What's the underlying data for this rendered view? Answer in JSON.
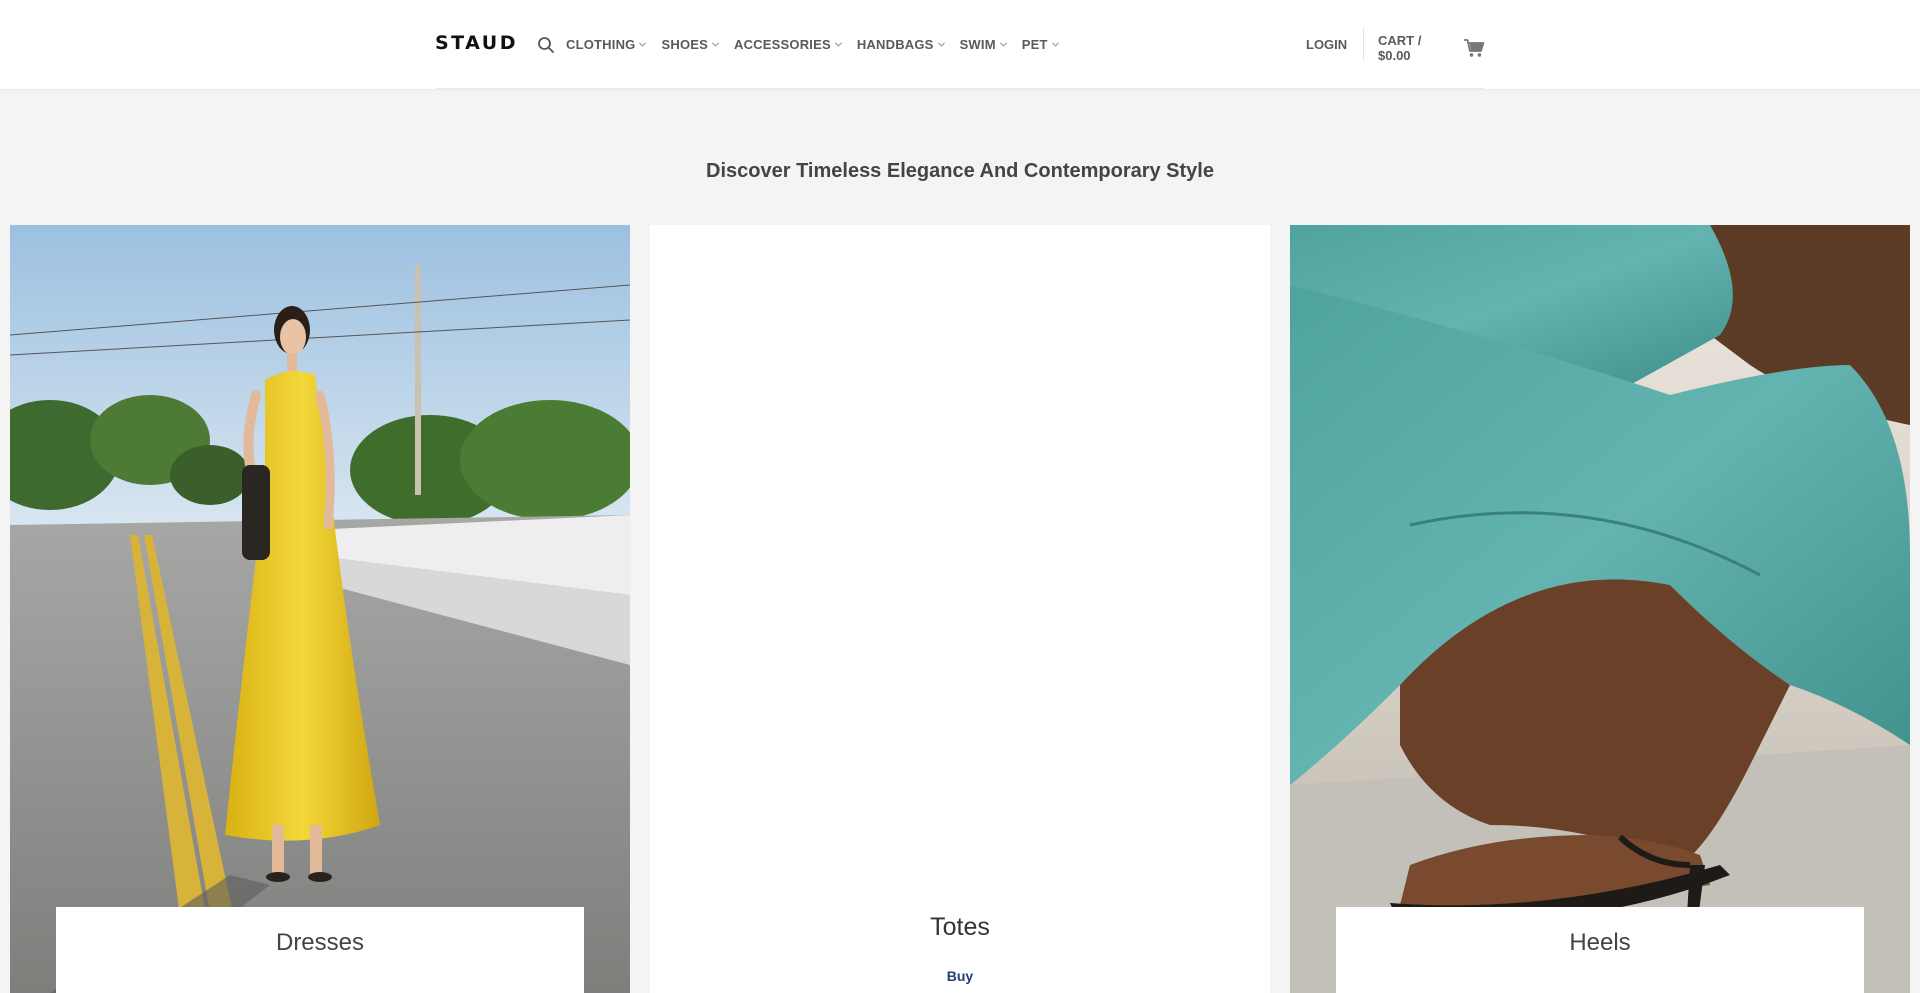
{
  "header": {
    "logo": "STAUD",
    "nav": [
      {
        "label": "CLOTHING"
      },
      {
        "label": "SHOES"
      },
      {
        "label": "ACCESSORIES"
      },
      {
        "label": "HANDBAGS"
      },
      {
        "label": "SWIM"
      },
      {
        "label": "PET"
      }
    ],
    "login_label": "LOGIN",
    "cart_label": "CART / $0.00"
  },
  "main": {
    "heading": "Discover Timeless Elegance And Contemporary Style",
    "cards": [
      {
        "title": "Dresses"
      },
      {
        "title": "Totes",
        "cta": "Buy"
      },
      {
        "title": "Heels"
      }
    ]
  },
  "colors": {
    "page_bg": "#f4f4f4",
    "header_bg": "#ffffff",
    "nav_text": "#5a5a5a",
    "link": "#1e3e6e"
  },
  "icons": [
    "search-icon",
    "chevron-down-icon",
    "cart-icon"
  ]
}
